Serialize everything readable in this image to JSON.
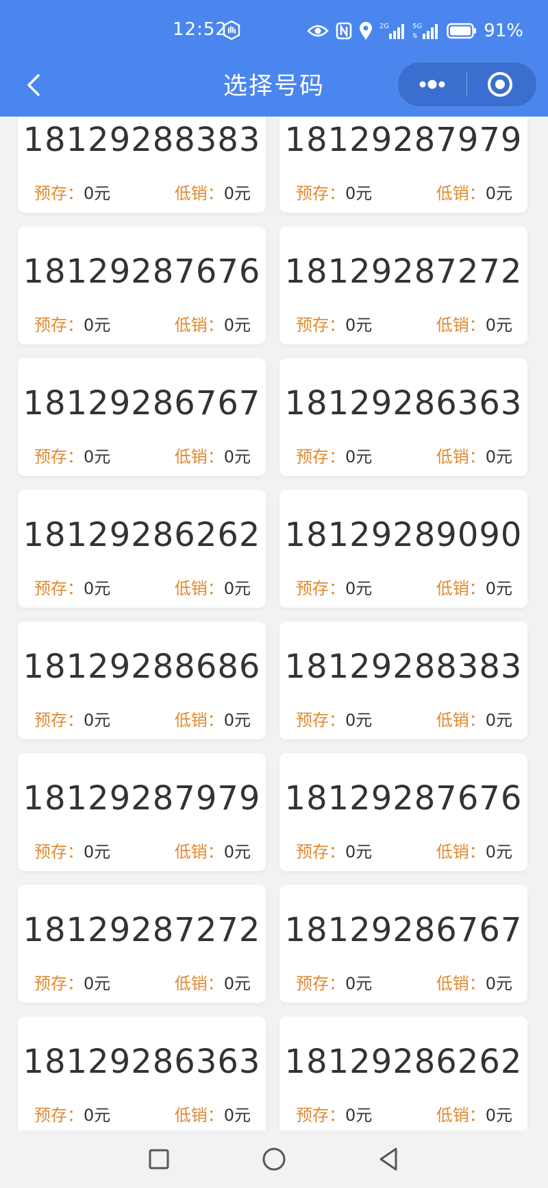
{
  "status": {
    "time": "12:52",
    "battery": "91%"
  },
  "header": {
    "title": "选择号码"
  },
  "labels": {
    "prestore": "预存：",
    "lowsale": "低销："
  },
  "numbers": [
    {
      "number": "18129288383",
      "prestore": "0元",
      "lowsale": "0元"
    },
    {
      "number": "18129287979",
      "prestore": "0元",
      "lowsale": "0元"
    },
    {
      "number": "18129287676",
      "prestore": "0元",
      "lowsale": "0元"
    },
    {
      "number": "18129287272",
      "prestore": "0元",
      "lowsale": "0元"
    },
    {
      "number": "18129286767",
      "prestore": "0元",
      "lowsale": "0元"
    },
    {
      "number": "18129286363",
      "prestore": "0元",
      "lowsale": "0元"
    },
    {
      "number": "18129286262",
      "prestore": "0元",
      "lowsale": "0元"
    },
    {
      "number": "18129289090",
      "prestore": "0元",
      "lowsale": "0元"
    },
    {
      "number": "18129288686",
      "prestore": "0元",
      "lowsale": "0元"
    },
    {
      "number": "18129288383",
      "prestore": "0元",
      "lowsale": "0元"
    },
    {
      "number": "18129287979",
      "prestore": "0元",
      "lowsale": "0元"
    },
    {
      "number": "18129287676",
      "prestore": "0元",
      "lowsale": "0元"
    },
    {
      "number": "18129287272",
      "prestore": "0元",
      "lowsale": "0元"
    },
    {
      "number": "18129286767",
      "prestore": "0元",
      "lowsale": "0元"
    },
    {
      "number": "18129286363",
      "prestore": "0元",
      "lowsale": "0元"
    },
    {
      "number": "18129286262",
      "prestore": "0元",
      "lowsale": "0元"
    }
  ],
  "colors": {
    "header_bg": "#4a86ee",
    "label_orange": "#e0892f",
    "text_dark": "#333333",
    "page_bg": "#f2f2f2"
  },
  "icons": {
    "status": [
      "hand-icon",
      "eye-icon",
      "nfc-icon",
      "location-icon",
      "signal-2g-icon",
      "signal-5g-icon",
      "battery-icon"
    ],
    "header": [
      "back-chevron-icon",
      "more-dots-icon",
      "target-circle-icon"
    ],
    "nav": [
      "recent-apps-square-icon",
      "home-circle-icon",
      "back-triangle-icon"
    ]
  }
}
